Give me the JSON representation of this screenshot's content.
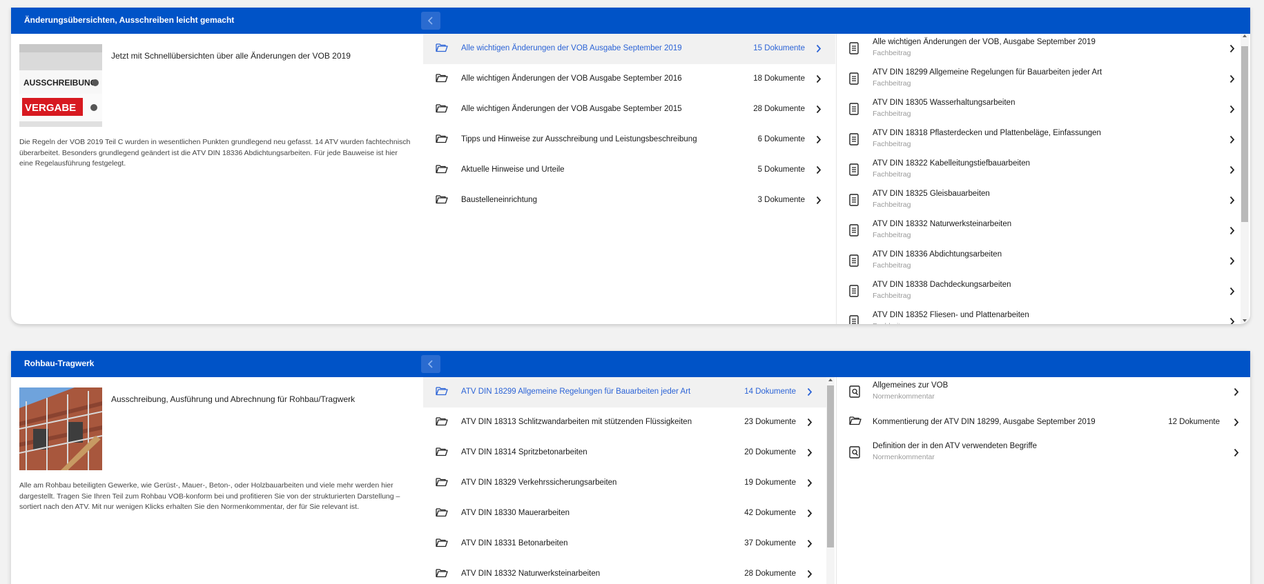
{
  "panels": [
    {
      "title": "Änderungsübersichten, Ausschreiben leicht gemacht",
      "image_labels": [
        "AUSSCHREIBUNG",
        "VERGABE"
      ],
      "heading": "Jetzt mit Schnellübersichten über alle Änderungen der VOB 2019",
      "description": "Die Regeln der VOB 2019 Teil C wurden in wesentlichen Punkten grundlegend neu gefasst. 14 ATV wurden fachtechnisch überarbeitet. Besonders grundlegend geändert ist die ATV DIN 18336 Abdichtungsarbeiten. Für jede Bauweise ist hier eine Regelausführung festgelegt.",
      "folders": [
        {
          "label": "Alle wichtigen Änderungen der VOB Ausgabe September 2019",
          "count": "15 Dokumente",
          "active": true
        },
        {
          "label": "Alle wichtigen Änderungen der VOB Ausgabe September 2016",
          "count": "18 Dokumente"
        },
        {
          "label": "Alle wichtigen Änderungen der VOB Ausgabe September 2015",
          "count": "28 Dokumente"
        },
        {
          "label": "Tipps und Hinweise zur Ausschreibung und Leistungsbeschreibung",
          "count": "6 Dokumente"
        },
        {
          "label": "Aktuelle Hinweise und Urteile",
          "count": "5 Dokumente"
        },
        {
          "label": "Baustelleneinrichtung",
          "count": "3 Dokumente"
        }
      ],
      "documents": [
        {
          "title": "Alle wichtigen Änderungen der VOB, Ausgabe September 2019",
          "type": "Fachbeitrag",
          "icon": "document-icon"
        },
        {
          "title": "ATV DIN 18299 Allgemeine Regelungen für Bauarbeiten jeder Art",
          "type": "Fachbeitrag",
          "icon": "document-icon"
        },
        {
          "title": "ATV DIN 18305 Wasserhaltungsarbeiten",
          "type": "Fachbeitrag",
          "icon": "document-icon"
        },
        {
          "title": "ATV DIN 18318 Pflasterdecken und Plattenbeläge, Einfassungen",
          "type": "Fachbeitrag",
          "icon": "document-icon"
        },
        {
          "title": "ATV DIN 18322 Kabelleitungstiefbauarbeiten",
          "type": "Fachbeitrag",
          "icon": "document-icon"
        },
        {
          "title": "ATV DIN 18325 Gleisbauarbeiten",
          "type": "Fachbeitrag",
          "icon": "document-icon"
        },
        {
          "title": "ATV DIN 18332 Naturwerksteinarbeiten",
          "type": "Fachbeitrag",
          "icon": "document-icon"
        },
        {
          "title": "ATV DIN 18336 Abdichtungsarbeiten",
          "type": "Fachbeitrag",
          "icon": "document-icon"
        },
        {
          "title": "ATV DIN 18338 Dachdeckungsarbeiten",
          "type": "Fachbeitrag",
          "icon": "document-icon"
        },
        {
          "title": "ATV DIN 18352 Fliesen- und Plattenarbeiten",
          "type": "Fachbeitrag",
          "icon": "document-icon"
        }
      ]
    },
    {
      "title": "Rohbau-Tragwerk",
      "heading": "Ausschreibung, Ausführung und Abrechnung für Rohbau/Tragwerk",
      "description": "Alle am Rohbau beteiligten Gewerke, wie Gerüst-, Mauer-, Beton-, oder Holzbauarbeiten und viele mehr werden hier dargestellt. Tragen Sie Ihren Teil zum Rohbau VOB-konform bei und profitieren Sie von der strukturierten Darstellung – sortiert nach den ATV. Mit nur wenigen Klicks erhalten Sie den Normenkommentar, der für Sie relevant ist.",
      "folders": [
        {
          "label": "ATV DIN 18299 Allgemeine Regelungen für Bauarbeiten jeder Art",
          "count": "14 Dokumente",
          "active": true
        },
        {
          "label": "ATV DIN 18313 Schlitzwandarbeiten mit stützenden Flüssigkeiten",
          "count": "23 Dokumente"
        },
        {
          "label": "ATV DIN 18314 Spritzbetonarbeiten",
          "count": "20 Dokumente"
        },
        {
          "label": "ATV DIN 18329 Verkehrssicherungsarbeiten",
          "count": "19 Dokumente"
        },
        {
          "label": "ATV DIN 18330 Mauerarbeiten",
          "count": "42 Dokumente"
        },
        {
          "label": "ATV DIN 18331 Betonarbeiten",
          "count": "37 Dokumente"
        },
        {
          "label": "ATV DIN 18332 Naturwerksteinarbeiten",
          "count": "28 Dokumente"
        }
      ],
      "documents": [
        {
          "title": "Allgemeines zur VOB",
          "type": "Normenkommentar",
          "icon": "commentary-icon"
        },
        {
          "title": "Kommentierung der ATV DIN 18299, Ausgabe September 2019",
          "count": "12 Dokumente",
          "icon": "folder-icon"
        },
        {
          "title": "Definition der in den ATV verwendeten Begriffe",
          "type": "Normenkommentar",
          "icon": "commentary-icon"
        }
      ]
    }
  ],
  "colors": {
    "header": "#0053c7",
    "active_text": "#2b63d6",
    "active_row": "#f1f1f1",
    "subtitle": "#9a9a9a"
  }
}
